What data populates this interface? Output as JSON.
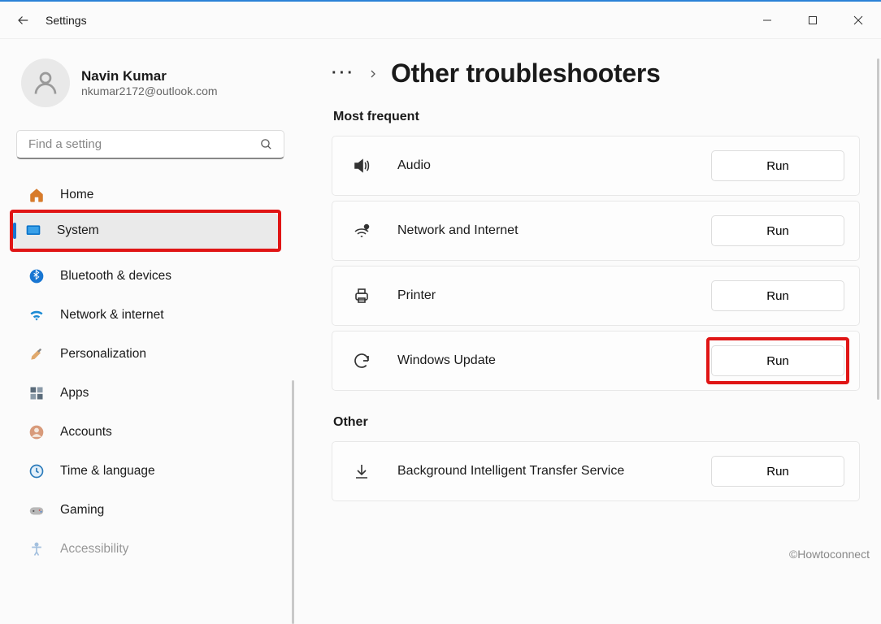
{
  "titlebar": {
    "title": "Settings"
  },
  "profile": {
    "name": "Navin Kumar",
    "email": "nkumar2172@outlook.com"
  },
  "search": {
    "placeholder": "Find a setting"
  },
  "nav": {
    "items": [
      {
        "label": "Home"
      },
      {
        "label": "System"
      },
      {
        "label": "Bluetooth & devices"
      },
      {
        "label": "Network & internet"
      },
      {
        "label": "Personalization"
      },
      {
        "label": "Apps"
      },
      {
        "label": "Accounts"
      },
      {
        "label": "Time & language"
      },
      {
        "label": "Gaming"
      },
      {
        "label": "Accessibility"
      }
    ]
  },
  "breadcrumb": {
    "title": "Other troubleshooters"
  },
  "sections": {
    "most_frequent": {
      "label": "Most frequent",
      "items": [
        {
          "label": "Audio",
          "button": "Run"
        },
        {
          "label": "Network and Internet",
          "button": "Run"
        },
        {
          "label": "Printer",
          "button": "Run"
        },
        {
          "label": "Windows Update",
          "button": "Run"
        }
      ]
    },
    "other": {
      "label": "Other",
      "items": [
        {
          "label": "Background Intelligent Transfer Service",
          "button": "Run"
        }
      ]
    }
  },
  "watermark": "©Howtoconnect"
}
